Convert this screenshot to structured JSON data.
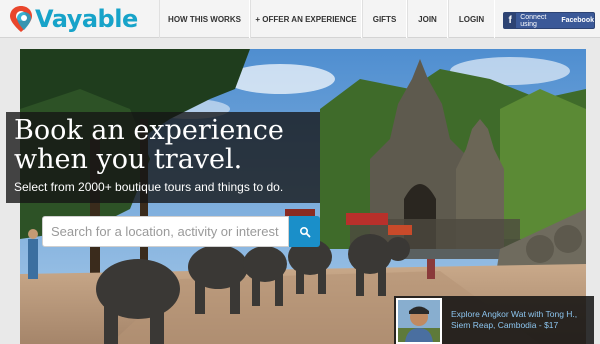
{
  "brand": {
    "name": "Vayable",
    "color": "#17a3c9"
  },
  "nav": {
    "items": [
      {
        "label": "HOW THIS WORKS"
      },
      {
        "label": "+ OFFER AN EXPERIENCE"
      },
      {
        "label": "GIFTS"
      },
      {
        "label": "JOIN"
      },
      {
        "label": "LOGIN"
      }
    ]
  },
  "facebook": {
    "label_prefix": "Connect using",
    "label_bold": "Facebook",
    "icon": "f",
    "color": "#3b5998"
  },
  "hero": {
    "headline": "Book an experience when you travel.",
    "subline": "Select from 2000+ boutique tours and things to do.",
    "search_placeholder": "Search for a location, activity or interest",
    "search_button_icon": "search-icon",
    "search_button_color": "#1a8fc9"
  },
  "promo": {
    "line1": "Explore Angkor Wat with Tong H.,",
    "line2": "Siem Reap, Cambodia - $17"
  }
}
